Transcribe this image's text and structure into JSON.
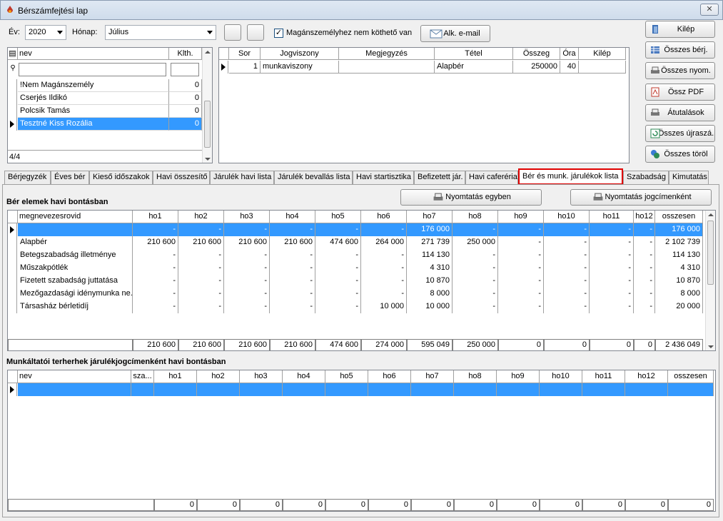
{
  "window": {
    "title": "Bérszámfejtési lap",
    "close": "✕"
  },
  "toolbar": {
    "ev_label": "Év:",
    "ev_value": "2020",
    "honap_label": "Hónap:",
    "honap_value": "Július",
    "check_label": "Magánszemélyhez nem köthető van",
    "email_btn": "Alk. e-mail"
  },
  "side_buttons": [
    "Kilép",
    "Összes bérj.",
    "Összes nyom.",
    "Össz PDF",
    "Átutalások",
    "Összes újraszá.",
    "Összes töröl"
  ],
  "persons": {
    "col_name": "nev",
    "col_klth": "Klth.",
    "rows": [
      {
        "name": "!Nem Magánszemély",
        "v": "0"
      },
      {
        "name": "Cserjés Ildikó",
        "v": "0"
      },
      {
        "name": "Polcsik Tamás",
        "v": "0"
      },
      {
        "name": "Tesztné Kiss Rozália",
        "v": "0"
      }
    ],
    "count": "4/4"
  },
  "items": {
    "headers": [
      "Sor",
      "Jogviszony",
      "Megjegyzés",
      "Tétel",
      "Összeg",
      "Óra",
      "Kilép"
    ],
    "rows": [
      [
        "1",
        "munkaviszony",
        "",
        "Alapbér",
        "250000",
        "40",
        ""
      ]
    ]
  },
  "tabs": [
    "Bérjegyzék",
    "Éves bér",
    "Kieső időszakok",
    "Havi összesítő",
    "Járulék havi lista",
    "Járulék bevallás lista",
    "Havi startisztika",
    "Befizetett jár.",
    "Havi caferéria",
    "Bér és munk. járulékok lista",
    "Szabadság",
    "Kimutatás"
  ],
  "section1": {
    "title": "Bér elemek havi bontásban",
    "print1": "Nyomtatás egyben",
    "print2": "Nyomtatás jogcímenként",
    "headers": [
      "megnevezesrovid",
      "ho1",
      "ho2",
      "ho3",
      "ho4",
      "ho5",
      "ho6",
      "ho7",
      "ho8",
      "ho9",
      "ho10",
      "ho11",
      "ho12",
      "osszesen"
    ],
    "rows": [
      [
        "",
        "-",
        "-",
        "-",
        "-",
        "-",
        "-",
        "176 000",
        "-",
        "-",
        "-",
        "-",
        "-",
        "176 000"
      ],
      [
        "Alapbér",
        "210 600",
        "210 600",
        "210 600",
        "210 600",
        "474 600",
        "264 000",
        "271 739",
        "250 000",
        "-",
        "-",
        "-",
        "-",
        "2 102 739"
      ],
      [
        "Betegszabadság illetménye",
        "-",
        "-",
        "-",
        "-",
        "-",
        "-",
        "114 130",
        "-",
        "-",
        "-",
        "-",
        "-",
        "114 130"
      ],
      [
        "Műszakpótlék",
        "-",
        "-",
        "-",
        "-",
        "-",
        "-",
        "4 310",
        "-",
        "-",
        "-",
        "-",
        "-",
        "4 310"
      ],
      [
        "Fizetett szabadság juttatása",
        "-",
        "-",
        "-",
        "-",
        "-",
        "-",
        "10 870",
        "-",
        "-",
        "-",
        "-",
        "-",
        "10 870"
      ],
      [
        "Mezőgazdasági idénymunka ne...",
        "-",
        "-",
        "-",
        "-",
        "-",
        "-",
        "8 000",
        "-",
        "-",
        "-",
        "-",
        "-",
        "8 000"
      ],
      [
        "Társasház bérletidíj",
        "-",
        "-",
        "-",
        "-",
        "-",
        "10 000",
        "10 000",
        "-",
        "-",
        "-",
        "-",
        "-",
        "20 000"
      ]
    ],
    "totals": [
      "210 600",
      "210 600",
      "210 600",
      "210 600",
      "474 600",
      "274 000",
      "595 049",
      "250 000",
      "0",
      "0",
      "0",
      "0",
      "2 436 049"
    ]
  },
  "section2": {
    "title": "Munkáltatói terherhek járulékjogcímenként havi bontásban",
    "headers": [
      "nev",
      "sza...",
      "ho1",
      "ho2",
      "ho3",
      "ho4",
      "ho5",
      "ho6",
      "ho7",
      "ho8",
      "ho9",
      "ho10",
      "ho11",
      "ho12",
      "osszesen"
    ],
    "totals": [
      "0",
      "0",
      "0",
      "0",
      "0",
      "0",
      "0",
      "0",
      "0",
      "0",
      "0",
      "0",
      "0"
    ]
  }
}
